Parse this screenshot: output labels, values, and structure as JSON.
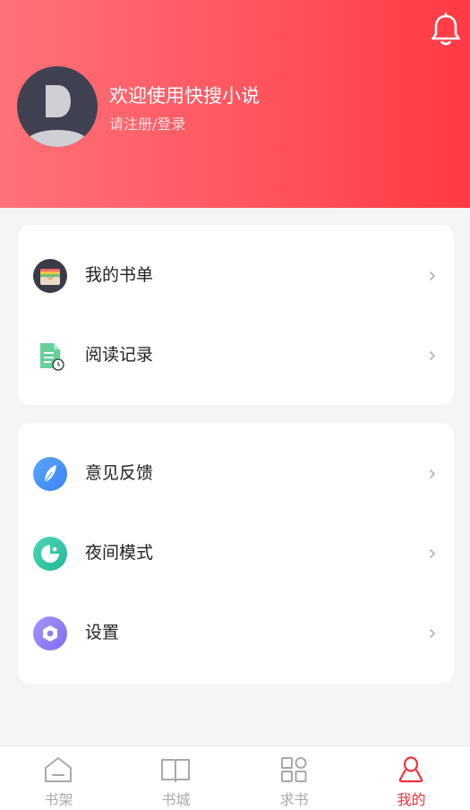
{
  "profile": {
    "welcome_text": "欢迎使用快搜小说",
    "login_text": "请注册/登录"
  },
  "menu_group_1": [
    {
      "label": "我的书单",
      "icon": "booklist-icon"
    },
    {
      "label": "阅读记录",
      "icon": "reading-history-icon"
    }
  ],
  "menu_group_2": [
    {
      "label": "意见反馈",
      "icon": "feedback-icon"
    },
    {
      "label": "夜间模式",
      "icon": "night-mode-icon"
    },
    {
      "label": "设置",
      "icon": "settings-icon"
    }
  ],
  "tabbar": {
    "tabs": [
      {
        "label": "书架",
        "icon": "home-bookshelf-icon"
      },
      {
        "label": "书城",
        "icon": "open-book-icon"
      },
      {
        "label": "求书",
        "icon": "grid-icon"
      },
      {
        "label": "我的",
        "icon": "user-icon"
      }
    ],
    "active_index": 3
  },
  "colors": {
    "accent": "#f2303b",
    "header_gradient_start": "#ff7178",
    "header_gradient_end": "#ff3a44",
    "tab_inactive": "#a9a9a9"
  }
}
